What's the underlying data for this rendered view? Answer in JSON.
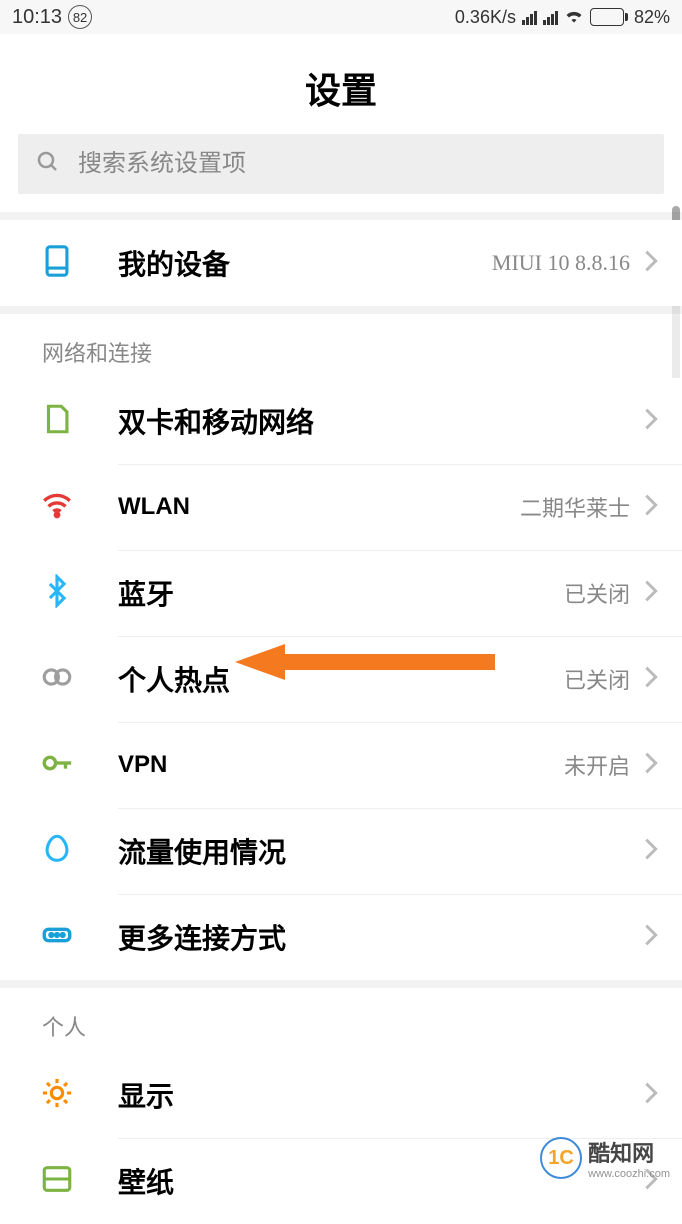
{
  "status": {
    "time": "10:13",
    "badge": "82",
    "net_speed": "0.36K/s",
    "battery_pct": "82%"
  },
  "header": {
    "title": "设置"
  },
  "search": {
    "placeholder": "搜索系统设置项"
  },
  "device_row": {
    "label": "我的设备",
    "value": "MIUI 10 8.8.16"
  },
  "sections": {
    "network": {
      "header": "网络和连接",
      "items": [
        {
          "label": "双卡和移动网络",
          "value": ""
        },
        {
          "label": "WLAN",
          "value": "二期华莱士"
        },
        {
          "label": "蓝牙",
          "value": "已关闭"
        },
        {
          "label": "个人热点",
          "value": "已关闭"
        },
        {
          "label": "VPN",
          "value": "未开启"
        },
        {
          "label": "流量使用情况",
          "value": ""
        },
        {
          "label": "更多连接方式",
          "value": ""
        }
      ]
    },
    "personal": {
      "header": "个人",
      "items": [
        {
          "label": "显示",
          "value": ""
        },
        {
          "label": "壁纸",
          "value": ""
        }
      ]
    }
  },
  "watermark": {
    "main": "酷知网",
    "sub": "www.coozhi.com",
    "logo": "1C"
  }
}
